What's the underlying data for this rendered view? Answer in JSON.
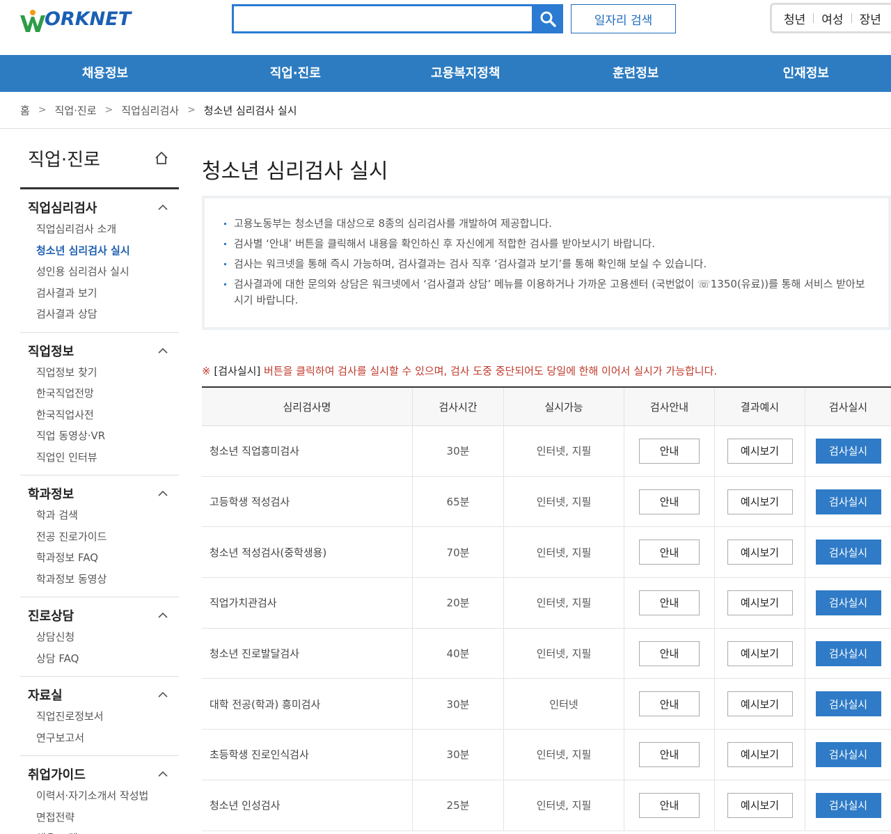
{
  "header": {
    "logo_text": "ORKNET",
    "search_placeholder": "",
    "job_search_label": "일자리 검색",
    "target_links": [
      "청년",
      "여성",
      "장년"
    ]
  },
  "gnb": [
    "채용정보",
    "직업·진로",
    "고용복지정책",
    "훈련정보",
    "인재정보"
  ],
  "breadcrumb": [
    "홈",
    "직업·진로",
    "직업심리검사",
    "청소년 심리검사 실시"
  ],
  "sidebar": {
    "title": "직업·진로",
    "groups": [
      {
        "title": "직업심리검사",
        "items": [
          "직업심리검사 소개",
          "청소년 심리검사 실시",
          "성인용 심리검사 실시",
          "검사결과 보기",
          "검사결과 상담"
        ]
      },
      {
        "title": "직업정보",
        "items": [
          "직업정보 찾기",
          "한국직업전망",
          "한국직업사전",
          "직업 동영상·VR",
          "직업인 인터뷰"
        ]
      },
      {
        "title": "학과정보",
        "items": [
          "학과 검색",
          "전공 진로가이드",
          "학과정보 FAQ",
          "학과정보 동영상"
        ]
      },
      {
        "title": "진로상담",
        "items": [
          "상담신청",
          "상담 FAQ"
        ]
      },
      {
        "title": "자료실",
        "items": [
          "직업진로정보서",
          "연구보고서"
        ]
      },
      {
        "title": "취업가이드",
        "items": [
          "이력서·자기소개서 작성법",
          "면접전략",
          "채용 트렌드"
        ]
      }
    ]
  },
  "main": {
    "title": "청소년 심리검사 실시",
    "info": [
      "고용노동부는 청소년을 대상으로 8종의 심리검사를 개발하여 제공합니다.",
      "검사별 ‘안내’ 버튼을 클릭해서 내용을 확인하신 후 자신에게 적합한 검사를 받아보시기 바랍니다.",
      "검사는 워크넷을 통해 즉시 가능하며, 검사결과는 검사 직후 ‘검사결과 보기’를 통해 확인해 보실 수 있습니다.",
      "검사결과에 대한 문의와 상담은 워크넷에서 ‘검사결과 상담’ 메뉴를 이용하거나 가까운 고용센터 (국번없이 ☏1350(유료))를 통해 서비스 받아보시기 바랍니다."
    ],
    "notice_mark": "※",
    "notice_bold": "[검사실시]",
    "notice_text": " 버튼을 클릭하여 검사를 실시할 수 있으며, 검사 도중 중단되어도 당일에 한해 이어서 실시가 가능합니다.",
    "table": {
      "headers": [
        "심리검사명",
        "검사시간",
        "실시가능",
        "검사안내",
        "결과예시",
        "검사실시"
      ],
      "guide_label": "안내",
      "example_label": "예시보기",
      "start_label": "검사실시",
      "rows": [
        {
          "name": "청소년 직업흥미검사",
          "time": "30분",
          "mode": "인터넷, 지필"
        },
        {
          "name": "고등학생 적성검사",
          "time": "65분",
          "mode": "인터넷, 지필"
        },
        {
          "name": "청소년 적성검사(중학생용)",
          "time": "70분",
          "mode": "인터넷, 지필"
        },
        {
          "name": "직업가치관검사",
          "time": "20분",
          "mode": "인터넷, 지필"
        },
        {
          "name": "청소년 진로발달검사",
          "time": "40분",
          "mode": "인터넷, 지필"
        },
        {
          "name": "대학 전공(학과) 흥미검사",
          "time": "30분",
          "mode": "인터넷"
        },
        {
          "name": "초등학생 진로인식검사",
          "time": "30분",
          "mode": "인터넷, 지필"
        },
        {
          "name": "청소년 인성검사",
          "time": "25분",
          "mode": "인터넷, 지필"
        }
      ]
    }
  },
  "colors": {
    "primary": "#2d7cc1",
    "logo_green": "#2e9c47",
    "logo_orange": "#f39c12",
    "notice": "#c0392b"
  }
}
